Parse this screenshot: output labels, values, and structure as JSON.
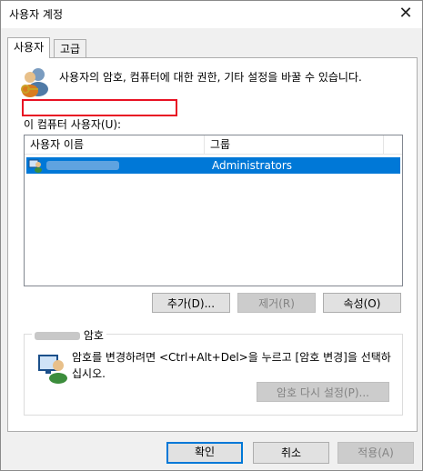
{
  "window": {
    "title": "사용자 계정",
    "close_glyph": "✕"
  },
  "tabs": [
    {
      "label": "사용자"
    },
    {
      "label": "고급"
    }
  ],
  "main": {
    "description": "사용자의 암호, 컴퓨터에 대한 권한, 기타 설정을 바꿀 수 있습니다.",
    "users_label": "이 컴퓨터 사용자(U):",
    "columns": [
      "사용자 이름",
      "그룹"
    ],
    "rows": [
      {
        "name": "",
        "group": "Administrators"
      }
    ],
    "buttons": {
      "add": "추가(D)...",
      "remove": "제거(R)",
      "properties": "속성(O)"
    }
  },
  "password_group": {
    "title_suffix": "암호",
    "text": "암호를 변경하려면 <Ctrl+Alt+Del>을 누르고 [암호 변경]을 선택하십시오.",
    "reset_button": "암호 다시 설정(P)..."
  },
  "footer": {
    "ok": "확인",
    "cancel": "취소",
    "apply": "적용(A)"
  },
  "colors": {
    "selection": "#0078d7",
    "highlight_box": "#e81123"
  }
}
